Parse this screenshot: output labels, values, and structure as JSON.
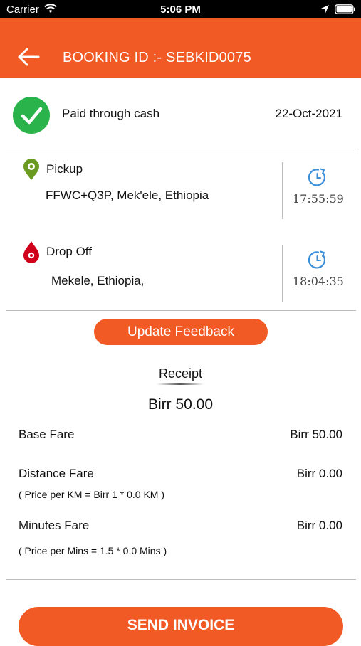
{
  "status_bar": {
    "carrier": "Carrier",
    "time": "5:06 PM",
    "icons": [
      "wifi-icon",
      "location-arrow-icon",
      "battery-icon"
    ]
  },
  "header": {
    "title": "BOOKING ID :- SEBKID0075",
    "back_icon": "back-arrow-icon",
    "color": "#f15a24"
  },
  "payment": {
    "status_icon": "check-circle-icon",
    "status_text": "Paid through cash",
    "date": "22-Oct-2021",
    "icon_color": "#2ab34a"
  },
  "trip": {
    "pickup": {
      "icon": "pickup-pin-icon",
      "label": "Pickup",
      "address": "FFWC+Q3P, Mek'ele, Ethiopia",
      "time": "17:55:59",
      "icon_color": "#6a9a1f"
    },
    "dropoff": {
      "icon": "dropoff-pin-icon",
      "label": "Drop Off",
      "address": "Mekele, Ethiopia,",
      "time": "18:04:35",
      "icon_color": "#d0021b"
    },
    "clock_icon": "clock-icon",
    "clock_color": "#3b8fd9"
  },
  "feedback_button": "Update Feedback",
  "receipt": {
    "title": "Receipt",
    "total": "Birr 50.00",
    "rows": [
      {
        "label": "Base Fare",
        "value": "Birr 50.00",
        "note": ""
      },
      {
        "label": "Distance Fare",
        "value": "Birr 0.00",
        "note": "( Price per KM =  Birr 1 * 0.0 KM )"
      },
      {
        "label": "Minutes Fare",
        "value": "Birr 0.00",
        "note": "( Price per Mins = 1.5 * 0.0 Mins )"
      }
    ]
  },
  "send_invoice_button": "SEND INVOICE"
}
